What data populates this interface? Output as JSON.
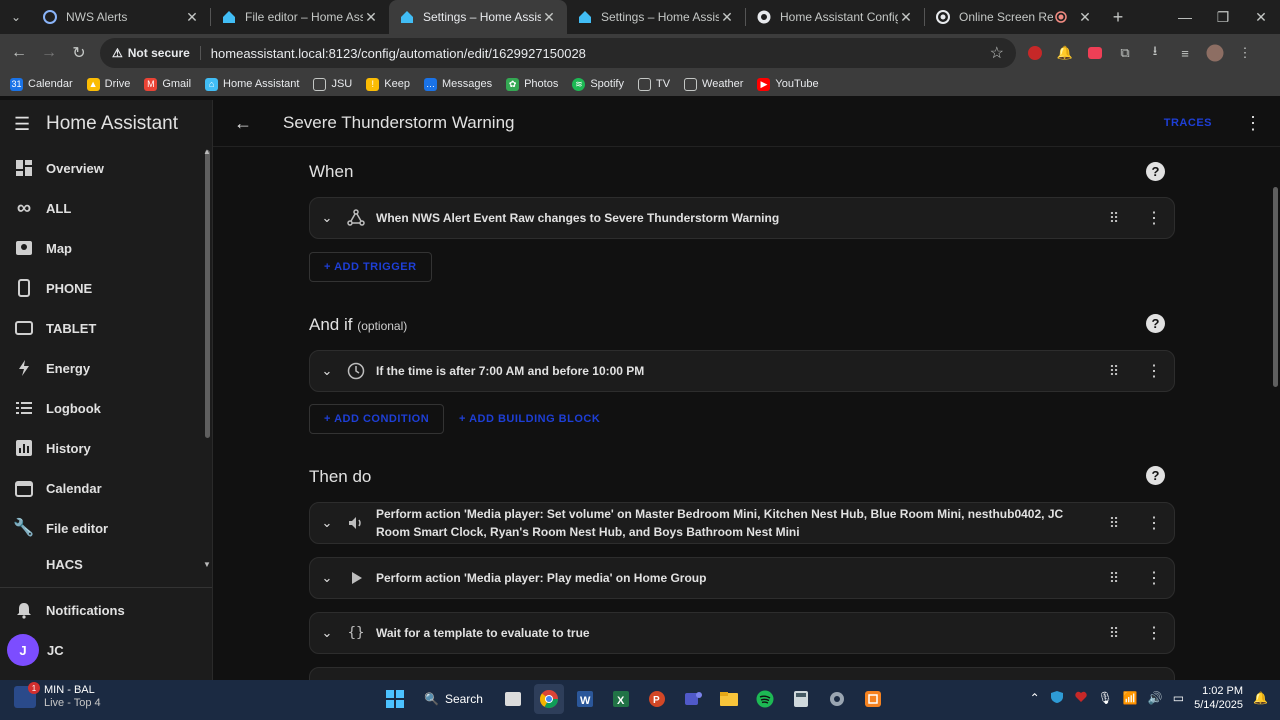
{
  "browser": {
    "tabs": [
      {
        "title": "NWS Alerts",
        "active": false
      },
      {
        "title": "File editor – Home Assistant",
        "active": false
      },
      {
        "title": "Settings – Home Assistant",
        "active": true
      },
      {
        "title": "Settings – Home Assistant",
        "active": false
      },
      {
        "title": "Home Assistant Configurat",
        "active": false
      },
      {
        "title": "Online Screen Recorde",
        "active": false
      }
    ],
    "security_label": "Not secure",
    "url": "homeassistant.local:8123/config/automation/edit/1629927150028",
    "bookmarks": [
      "Calendar",
      "Drive",
      "Gmail",
      "Home Assistant",
      "JSU",
      "Keep",
      "Messages",
      "Photos",
      "Spotify",
      "TV",
      "Weather",
      "YouTube"
    ]
  },
  "sidebar": {
    "brand": "Home Assistant",
    "items": [
      {
        "label": "Overview",
        "icon": "dashboard-icon"
      },
      {
        "label": "ALL",
        "icon": "infinity-icon"
      },
      {
        "label": "Map",
        "icon": "map-icon"
      },
      {
        "label": "PHONE",
        "icon": "phone-icon"
      },
      {
        "label": "TABLET",
        "icon": "tablet-icon"
      },
      {
        "label": "Energy",
        "icon": "lightning-icon"
      },
      {
        "label": "Logbook",
        "icon": "logbook-icon"
      },
      {
        "label": "History",
        "icon": "chart-icon"
      },
      {
        "label": "Calendar",
        "icon": "calendar-icon"
      },
      {
        "label": "File editor",
        "icon": "wrench-icon"
      },
      {
        "label": "HACS",
        "icon": "hacs-icon"
      }
    ],
    "notifications_label": "Notifications",
    "user_initial": "J",
    "user_name": "JC"
  },
  "header": {
    "title": "Severe Thunderstorm Warning",
    "trace_label": "TRACES"
  },
  "editor": {
    "when": {
      "title": "When",
      "triggers": [
        "When NWS Alert Event Raw changes to Severe Thunderstorm Warning"
      ],
      "add_label": "+ ADD TRIGGER"
    },
    "and_if": {
      "title": "And if",
      "optional": "(optional)",
      "conditions": [
        "If the time is after 7:00 AM and before 10:00 PM"
      ],
      "add_label": "+ ADD CONDITION",
      "add_block_label": "+ ADD BUILDING BLOCK"
    },
    "then_do": {
      "title": "Then do",
      "actions": [
        {
          "text": "Perform action 'Media player: Set volume' on Master Bedroom Mini, Kitchen Nest Hub, Blue Room Mini, nesthub0402, JC Room Smart Clock, Ryan's Room Nest Hub, and Boys Bathroom Nest Mini",
          "icon": "volume-icon"
        },
        {
          "text": "Perform action 'Media player: Play media' on Home Group",
          "icon": "play-icon"
        },
        {
          "text": "Wait for a template to evaluate to true",
          "icon": "braces-icon"
        }
      ]
    }
  },
  "taskbar": {
    "widget_title": "MIN - BAL",
    "widget_sub": "Live - Top 4",
    "widget_badge": "1",
    "search_label": "Search",
    "time": "1:02 PM",
    "date": "5/14/2025"
  }
}
